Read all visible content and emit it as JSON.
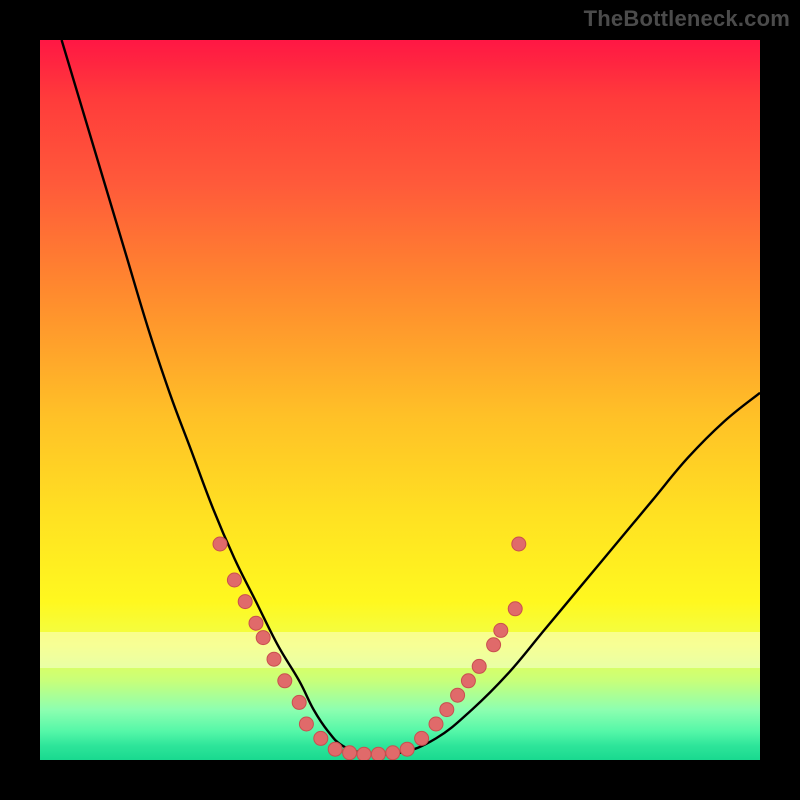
{
  "watermark": "TheBottleneck.com",
  "colors": {
    "background": "#000000",
    "curve": "#000000",
    "dot_fill": "#e06a6a",
    "dot_stroke": "#c94f4f",
    "gradient_top": "#ff1744",
    "gradient_mid": "#ffe122",
    "gradient_bottom": "#19d98f"
  },
  "chart_data": {
    "type": "line",
    "title": "",
    "xlabel": "",
    "ylabel": "",
    "xlim": [
      0,
      100
    ],
    "ylim": [
      0,
      100
    ],
    "series": [
      {
        "name": "bottleneck-curve",
        "x": [
          3,
          6,
          9,
          12,
          15,
          18,
          21,
          24,
          27,
          30,
          33,
          36,
          38,
          40,
          42,
          45,
          50,
          55,
          60,
          65,
          70,
          75,
          80,
          85,
          90,
          95,
          100
        ],
        "y": [
          100,
          90,
          80,
          70,
          60,
          51,
          43,
          35,
          28,
          22,
          16,
          11,
          7,
          4,
          2,
          1,
          1,
          3,
          7,
          12,
          18,
          24,
          30,
          36,
          42,
          47,
          51
        ]
      }
    ],
    "markers": {
      "name": "sample-dots",
      "points": [
        {
          "x": 25,
          "y": 30
        },
        {
          "x": 27,
          "y": 25
        },
        {
          "x": 28.5,
          "y": 22
        },
        {
          "x": 30,
          "y": 19
        },
        {
          "x": 31,
          "y": 17
        },
        {
          "x": 32.5,
          "y": 14
        },
        {
          "x": 34,
          "y": 11
        },
        {
          "x": 36,
          "y": 8
        },
        {
          "x": 37,
          "y": 5
        },
        {
          "x": 39,
          "y": 3
        },
        {
          "x": 41,
          "y": 1.5
        },
        {
          "x": 43,
          "y": 1
        },
        {
          "x": 45,
          "y": 0.8
        },
        {
          "x": 47,
          "y": 0.8
        },
        {
          "x": 49,
          "y": 1
        },
        {
          "x": 51,
          "y": 1.5
        },
        {
          "x": 53,
          "y": 3
        },
        {
          "x": 55,
          "y": 5
        },
        {
          "x": 56.5,
          "y": 7
        },
        {
          "x": 58,
          "y": 9
        },
        {
          "x": 59.5,
          "y": 11
        },
        {
          "x": 61,
          "y": 13
        },
        {
          "x": 63,
          "y": 16
        },
        {
          "x": 64,
          "y": 18
        },
        {
          "x": 66,
          "y": 21
        },
        {
          "x": 66.5,
          "y": 30
        }
      ]
    }
  }
}
